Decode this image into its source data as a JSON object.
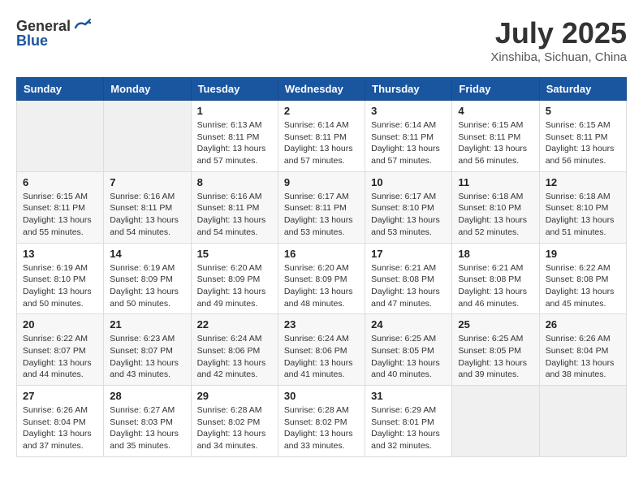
{
  "header": {
    "logo_general": "General",
    "logo_blue": "Blue",
    "month_title": "July 2025",
    "location": "Xinshiba, Sichuan, China"
  },
  "weekdays": [
    "Sunday",
    "Monday",
    "Tuesday",
    "Wednesday",
    "Thursday",
    "Friday",
    "Saturday"
  ],
  "weeks": [
    [
      {
        "day": "",
        "sunrise": "",
        "sunset": "",
        "daylight": ""
      },
      {
        "day": "",
        "sunrise": "",
        "sunset": "",
        "daylight": ""
      },
      {
        "day": "1",
        "sunrise": "Sunrise: 6:13 AM",
        "sunset": "Sunset: 8:11 PM",
        "daylight": "Daylight: 13 hours and 57 minutes."
      },
      {
        "day": "2",
        "sunrise": "Sunrise: 6:14 AM",
        "sunset": "Sunset: 8:11 PM",
        "daylight": "Daylight: 13 hours and 57 minutes."
      },
      {
        "day": "3",
        "sunrise": "Sunrise: 6:14 AM",
        "sunset": "Sunset: 8:11 PM",
        "daylight": "Daylight: 13 hours and 57 minutes."
      },
      {
        "day": "4",
        "sunrise": "Sunrise: 6:15 AM",
        "sunset": "Sunset: 8:11 PM",
        "daylight": "Daylight: 13 hours and 56 minutes."
      },
      {
        "day": "5",
        "sunrise": "Sunrise: 6:15 AM",
        "sunset": "Sunset: 8:11 PM",
        "daylight": "Daylight: 13 hours and 56 minutes."
      }
    ],
    [
      {
        "day": "6",
        "sunrise": "Sunrise: 6:15 AM",
        "sunset": "Sunset: 8:11 PM",
        "daylight": "Daylight: 13 hours and 55 minutes."
      },
      {
        "day": "7",
        "sunrise": "Sunrise: 6:16 AM",
        "sunset": "Sunset: 8:11 PM",
        "daylight": "Daylight: 13 hours and 54 minutes."
      },
      {
        "day": "8",
        "sunrise": "Sunrise: 6:16 AM",
        "sunset": "Sunset: 8:11 PM",
        "daylight": "Daylight: 13 hours and 54 minutes."
      },
      {
        "day": "9",
        "sunrise": "Sunrise: 6:17 AM",
        "sunset": "Sunset: 8:11 PM",
        "daylight": "Daylight: 13 hours and 53 minutes."
      },
      {
        "day": "10",
        "sunrise": "Sunrise: 6:17 AM",
        "sunset": "Sunset: 8:10 PM",
        "daylight": "Daylight: 13 hours and 53 minutes."
      },
      {
        "day": "11",
        "sunrise": "Sunrise: 6:18 AM",
        "sunset": "Sunset: 8:10 PM",
        "daylight": "Daylight: 13 hours and 52 minutes."
      },
      {
        "day": "12",
        "sunrise": "Sunrise: 6:18 AM",
        "sunset": "Sunset: 8:10 PM",
        "daylight": "Daylight: 13 hours and 51 minutes."
      }
    ],
    [
      {
        "day": "13",
        "sunrise": "Sunrise: 6:19 AM",
        "sunset": "Sunset: 8:10 PM",
        "daylight": "Daylight: 13 hours and 50 minutes."
      },
      {
        "day": "14",
        "sunrise": "Sunrise: 6:19 AM",
        "sunset": "Sunset: 8:09 PM",
        "daylight": "Daylight: 13 hours and 50 minutes."
      },
      {
        "day": "15",
        "sunrise": "Sunrise: 6:20 AM",
        "sunset": "Sunset: 8:09 PM",
        "daylight": "Daylight: 13 hours and 49 minutes."
      },
      {
        "day": "16",
        "sunrise": "Sunrise: 6:20 AM",
        "sunset": "Sunset: 8:09 PM",
        "daylight": "Daylight: 13 hours and 48 minutes."
      },
      {
        "day": "17",
        "sunrise": "Sunrise: 6:21 AM",
        "sunset": "Sunset: 8:08 PM",
        "daylight": "Daylight: 13 hours and 47 minutes."
      },
      {
        "day": "18",
        "sunrise": "Sunrise: 6:21 AM",
        "sunset": "Sunset: 8:08 PM",
        "daylight": "Daylight: 13 hours and 46 minutes."
      },
      {
        "day": "19",
        "sunrise": "Sunrise: 6:22 AM",
        "sunset": "Sunset: 8:08 PM",
        "daylight": "Daylight: 13 hours and 45 minutes."
      }
    ],
    [
      {
        "day": "20",
        "sunrise": "Sunrise: 6:22 AM",
        "sunset": "Sunset: 8:07 PM",
        "daylight": "Daylight: 13 hours and 44 minutes."
      },
      {
        "day": "21",
        "sunrise": "Sunrise: 6:23 AM",
        "sunset": "Sunset: 8:07 PM",
        "daylight": "Daylight: 13 hours and 43 minutes."
      },
      {
        "day": "22",
        "sunrise": "Sunrise: 6:24 AM",
        "sunset": "Sunset: 8:06 PM",
        "daylight": "Daylight: 13 hours and 42 minutes."
      },
      {
        "day": "23",
        "sunrise": "Sunrise: 6:24 AM",
        "sunset": "Sunset: 8:06 PM",
        "daylight": "Daylight: 13 hours and 41 minutes."
      },
      {
        "day": "24",
        "sunrise": "Sunrise: 6:25 AM",
        "sunset": "Sunset: 8:05 PM",
        "daylight": "Daylight: 13 hours and 40 minutes."
      },
      {
        "day": "25",
        "sunrise": "Sunrise: 6:25 AM",
        "sunset": "Sunset: 8:05 PM",
        "daylight": "Daylight: 13 hours and 39 minutes."
      },
      {
        "day": "26",
        "sunrise": "Sunrise: 6:26 AM",
        "sunset": "Sunset: 8:04 PM",
        "daylight": "Daylight: 13 hours and 38 minutes."
      }
    ],
    [
      {
        "day": "27",
        "sunrise": "Sunrise: 6:26 AM",
        "sunset": "Sunset: 8:04 PM",
        "daylight": "Daylight: 13 hours and 37 minutes."
      },
      {
        "day": "28",
        "sunrise": "Sunrise: 6:27 AM",
        "sunset": "Sunset: 8:03 PM",
        "daylight": "Daylight: 13 hours and 35 minutes."
      },
      {
        "day": "29",
        "sunrise": "Sunrise: 6:28 AM",
        "sunset": "Sunset: 8:02 PM",
        "daylight": "Daylight: 13 hours and 34 minutes."
      },
      {
        "day": "30",
        "sunrise": "Sunrise: 6:28 AM",
        "sunset": "Sunset: 8:02 PM",
        "daylight": "Daylight: 13 hours and 33 minutes."
      },
      {
        "day": "31",
        "sunrise": "Sunrise: 6:29 AM",
        "sunset": "Sunset: 8:01 PM",
        "daylight": "Daylight: 13 hours and 32 minutes."
      },
      {
        "day": "",
        "sunrise": "",
        "sunset": "",
        "daylight": ""
      },
      {
        "day": "",
        "sunrise": "",
        "sunset": "",
        "daylight": ""
      }
    ]
  ]
}
